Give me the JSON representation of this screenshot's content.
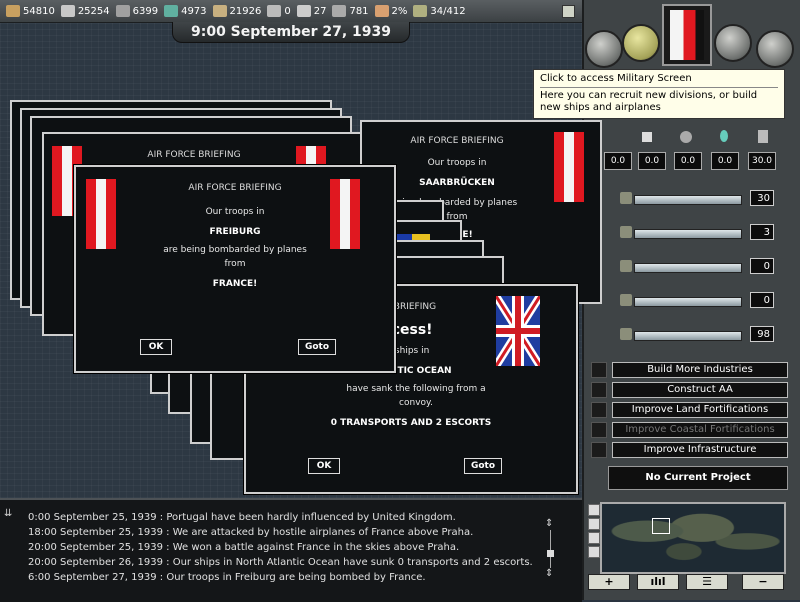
{
  "resources": [
    {
      "name": "energy",
      "value": "54810",
      "icon": "coal-icon",
      "color": "#c8a060"
    },
    {
      "name": "metal",
      "value": "25254",
      "icon": "steel-icon",
      "color": "#c8c8c8"
    },
    {
      "name": "rare",
      "value": "6399",
      "icon": "rare-materials-icon",
      "color": "#a0a0a0"
    },
    {
      "name": "oil",
      "value": "4973",
      "icon": "oil-drop-icon",
      "color": "#60b0a0"
    },
    {
      "name": "supplies",
      "value": "21926",
      "icon": "supplies-icon",
      "color": "#c8b080"
    },
    {
      "name": "money",
      "value": "0",
      "icon": "tools-icon",
      "color": "#bbbbbb"
    },
    {
      "name": "transports",
      "value": "27",
      "icon": "envelope-icon",
      "color": "#cccccc"
    },
    {
      "name": "manpower",
      "value": "781",
      "icon": "soldier-icon",
      "color": "#aaaaaa"
    },
    {
      "name": "dissent",
      "value": "2%",
      "icon": "fist-icon",
      "color": "#d9a070"
    },
    {
      "name": "ic",
      "value": "34/412",
      "icon": "factory-icon",
      "color": "#b0b080"
    }
  ],
  "date": "9:00 September 27, 1939",
  "tooltip": {
    "line1": "Click to access Military Screen",
    "line2": "Here you can recruit new divisions, or build new ships and airplanes"
  },
  "stats": [
    "0.0",
    "0.0",
    "0.0",
    "0.0",
    "30.0"
  ],
  "sliders": [
    {
      "value": "30",
      "fill": 1.0
    },
    {
      "value": "3",
      "fill": 0.08
    },
    {
      "value": "0",
      "fill": 0.0
    },
    {
      "value": "0",
      "fill": 0.0
    },
    {
      "value": "98",
      "fill": 1.0
    }
  ],
  "projects": [
    {
      "label": "Build More Industries",
      "enabled": true
    },
    {
      "label": "Construct AA",
      "enabled": true
    },
    {
      "label": "Improve Land Fortifications",
      "enabled": true
    },
    {
      "label": "Improve Coastal Fortifications",
      "enabled": false
    },
    {
      "label": "Improve Infrastructure",
      "enabled": true
    }
  ],
  "no_project": "No Current Project",
  "minimap_buttons": [
    "+",
    "ılıl",
    "☰",
    "−"
  ],
  "log": [
    "0:00 September 25, 1939 : Portugal have been hardly influenced by United Kingdom.",
    "18:00 September 25, 1939 : We are attacked by hostile airplanes of France above Praha.",
    "20:00 September 25, 1939 : We won a battle against France in the skies above Praha.",
    "20:00 September 26, 1939 : Our ships in North Atlantic Ocean have sunk 0 transports and 2 escorts.",
    "6:00 September 27, 1939 : Our troops in Freiburg are being bombed by France."
  ],
  "dialog_front": {
    "title": "AIR FORCE BRIEFING",
    "line1": "Our troops in",
    "place": "FREIBURG",
    "line2": "are being bombarded by planes",
    "line3": "from",
    "country": "FRANCE!",
    "ok": "OK",
    "goto": "Goto"
  },
  "dialog_back_title": "AIR FORCE BRIEFING",
  "dialog_saar": {
    "title": "AIR FORCE BRIEFING",
    "line1": "Our troops in",
    "place": "SAARBRÜCKEN",
    "line2": "eing bombarded by planes",
    "line3": "from",
    "country": "ANCE!"
  },
  "dialog_navy": {
    "title": "L BRIEFING",
    "headline": "ccess!",
    "line1": "ur ships in",
    "place": "N TLANTIC OCEAN",
    "line2": "have sank the following from a",
    "line3": "convoy.",
    "result": "0 TRANSPORTS AND 2 ESCORTS",
    "ok": "OK",
    "goto": "Goto"
  }
}
